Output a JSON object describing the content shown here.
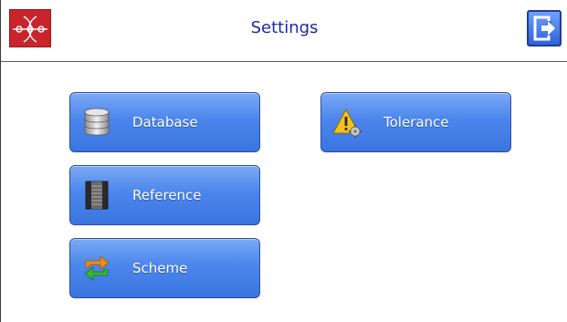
{
  "header": {
    "title": "Settings"
  },
  "buttons": [
    {
      "label": "Database",
      "icon": "database-icon"
    },
    {
      "label": "Reference",
      "icon": "film-reel-icon"
    },
    {
      "label": "Scheme",
      "icon": "swap-arrows-icon"
    },
    {
      "label": "Tolerance",
      "icon": "warning-gear-icon"
    }
  ],
  "colors": {
    "title": "#1a2aa8",
    "button_top": "#7aa9f5",
    "button_bottom": "#3a74e0",
    "logo_red": "#c8242c"
  }
}
